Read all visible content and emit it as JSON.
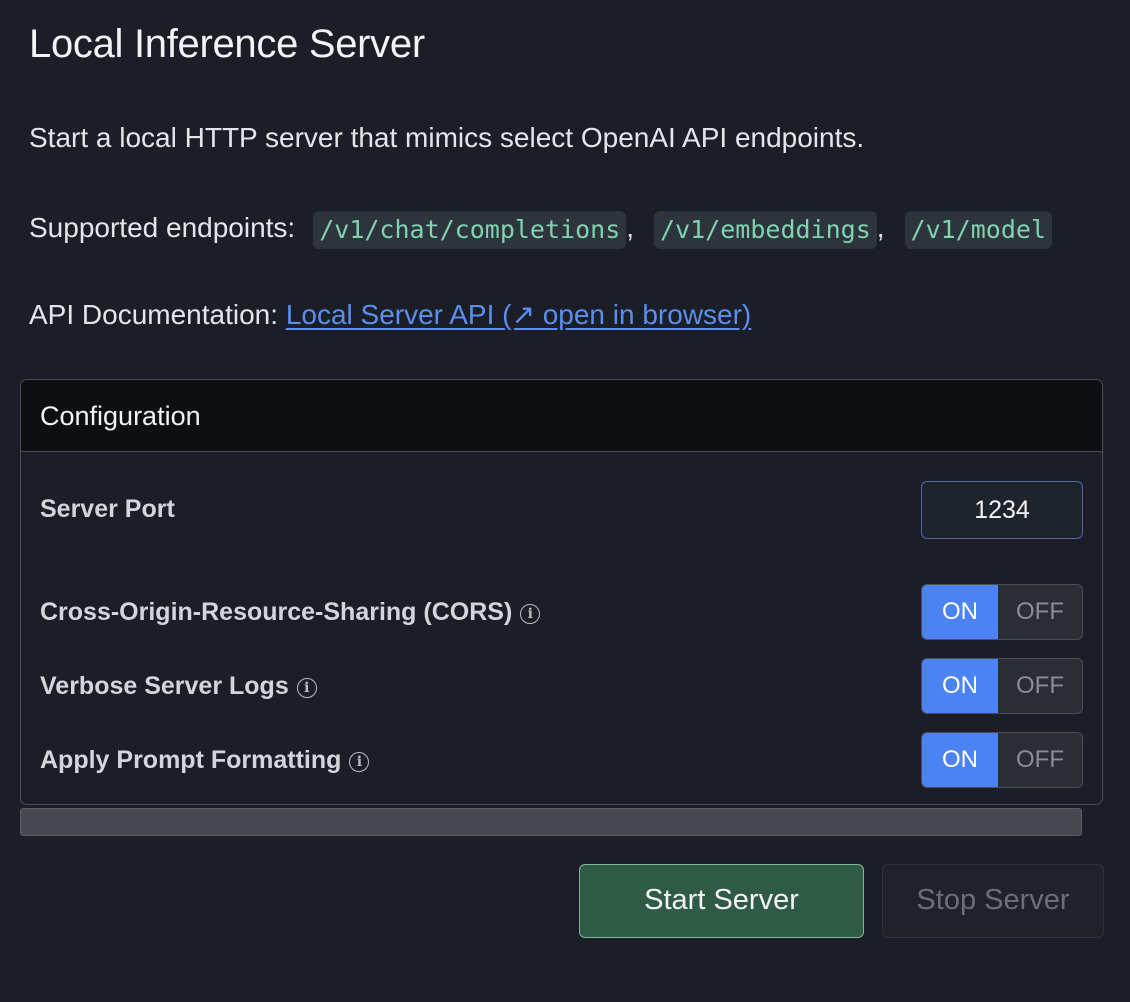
{
  "page": {
    "title": "Local Inference Server",
    "description": "Start a local HTTP server that mimics select OpenAI API endpoints.",
    "endpoints_label": "Supported endpoints:",
    "endpoints": [
      "/v1/chat/completions",
      "/v1/embeddings",
      "/v1/model"
    ],
    "docs_label": "API Documentation:",
    "docs_link": "Local Server API (↗ open in browser)"
  },
  "config": {
    "header": "Configuration",
    "port_label": "Server Port",
    "port_value": "1234",
    "cors_label": "Cross-Origin-Resource-Sharing (CORS)",
    "verbose_label": "Verbose Server Logs",
    "prompt_label": "Apply Prompt Formatting",
    "toggle_on": "ON",
    "toggle_off": "OFF",
    "cors_state": "ON",
    "verbose_state": "ON",
    "prompt_state": "ON",
    "info_icon": "i"
  },
  "actions": {
    "start_label": "Start Server",
    "stop_label": "Stop Server"
  },
  "colors": {
    "background": "#1b1e26",
    "accent_on": "#4b84f2",
    "start_button": "#2e5a46",
    "link": "#5a8ff0",
    "code": "#7fd3b0"
  }
}
